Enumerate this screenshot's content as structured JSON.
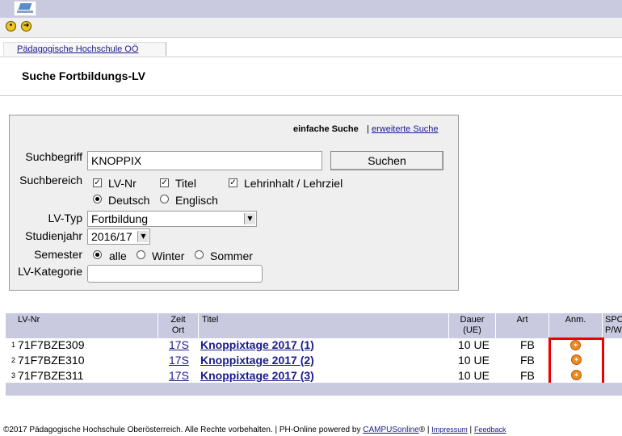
{
  "colors": {
    "header_bg": "#c9c9e0",
    "link": "#1a1a8e",
    "highlight": "#e00000"
  },
  "icons": {
    "logo": "ph-logo",
    "nav_back": "circle-dot-icon",
    "nav_forward": "arrow-right-icon",
    "anm": "registration-icon"
  },
  "tab": {
    "label": "Pädagogische Hochschule OÖ"
  },
  "page": {
    "title": "Suche Fortbildungs-LV"
  },
  "search": {
    "mode_simple": "einfache Suche",
    "mode_sep": "|",
    "mode_advanced": "erweiterte Suche",
    "suchbegriff_label": "Suchbegriff",
    "suchbegriff_value": "KNOPPIX",
    "suchen_button": "Suchen",
    "suchbereich_label": "Suchbereich",
    "check_lvnr": "LV-Nr",
    "check_titel": "Titel",
    "check_lehrinhalt": "Lehrinhalt / Lehrziel",
    "radio_deutsch": "Deutsch",
    "radio_englisch": "Englisch",
    "lvtyp_label": "LV-Typ",
    "lvtyp_value": "Fortbildung",
    "studienjahr_label": "Studienjahr",
    "studienjahr_value": "2016/17",
    "semester_label": "Semester",
    "semester_alle": "alle",
    "semester_winter": "Winter",
    "semester_sommer": "Sommer",
    "kategorie_label": "LV-Kategorie",
    "kategorie_value": ""
  },
  "table": {
    "headers": {
      "lvnr": "LV-Nr",
      "zeit": "Zeit",
      "ort": "Ort",
      "titel": "Titel",
      "dauer": "Dauer",
      "dauer_unit": "(UE)",
      "art": "Art",
      "anm": "Anm.",
      "spo": "SPO",
      "spo2": "P/W"
    },
    "rows": [
      {
        "num": "1",
        "lvnr": "71F7BZE309",
        "zeit": "17S",
        "titel": "Knoppixtage 2017 (1)",
        "dauer": "10 UE",
        "art": "FB"
      },
      {
        "num": "2",
        "lvnr": "71F7BZE310",
        "zeit": "17S",
        "titel": "Knoppixtage 2017 (2)",
        "dauer": "10 UE",
        "art": "FB"
      },
      {
        "num": "3",
        "lvnr": "71F7BZE311",
        "zeit": "17S",
        "titel": "Knoppixtage 2017 (3)",
        "dauer": "10 UE",
        "art": "FB"
      }
    ]
  },
  "footer": {
    "copyright": "©2017 Pädagogische Hochschule Oberösterreich. Alle Rechte vorbehalten. | PH-Online powered by",
    "campus": "CAMPUSonline",
    "reg": "® |",
    "impressum": "Impressum",
    "sep": "|",
    "feedback": "Feedback"
  }
}
